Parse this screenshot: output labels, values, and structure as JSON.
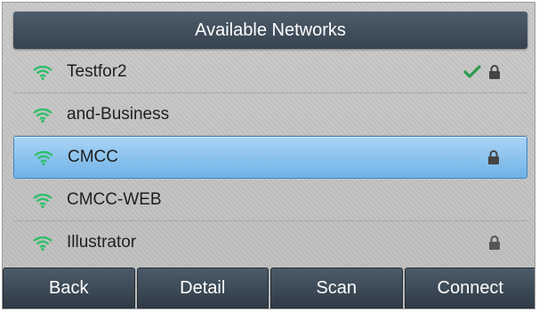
{
  "title": "Available Networks",
  "networks": [
    {
      "name": "Testfor2",
      "connected": true,
      "secured": true,
      "selected": false
    },
    {
      "name": "and-Business",
      "connected": false,
      "secured": false,
      "selected": false
    },
    {
      "name": "CMCC",
      "connected": false,
      "secured": true,
      "selected": true
    },
    {
      "name": "CMCC-WEB",
      "connected": false,
      "secured": false,
      "selected": false
    },
    {
      "name": "Illustrator",
      "connected": false,
      "secured": true,
      "selected": false
    }
  ],
  "softkeys": {
    "back": "Back",
    "detail": "Detail",
    "scan": "Scan",
    "connect": "Connect"
  },
  "colors": {
    "wifi": "#2fbf6a",
    "check": "#2a9a4a",
    "lock": "#444444",
    "selection": "#7bbaea",
    "softkey": "#3a4755"
  },
  "icons": {
    "wifi": "wifi-icon",
    "check": "check-icon",
    "lock": "lock-icon"
  }
}
